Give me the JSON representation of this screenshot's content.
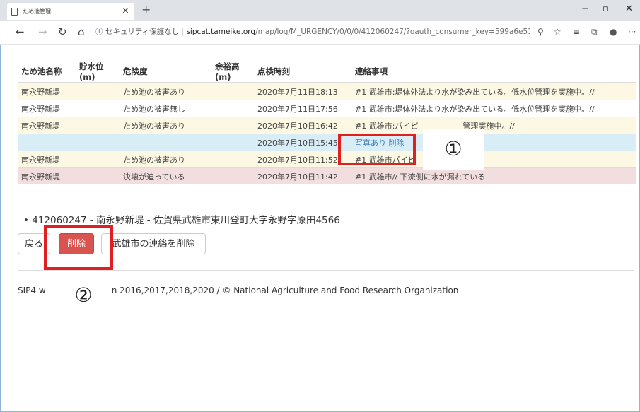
{
  "browser": {
    "tab_title": "ため池管理",
    "tab_close": "×",
    "new_tab": "+",
    "url_security": "ⓘ セキュリティ保護なし",
    "url_host": "sipcat.tameike.org",
    "url_path": "/map/log/M_URGENCY/0/0/0/412060247/?oauth_consumer_key=599a6e5190904..."
  },
  "table": {
    "headers": {
      "name": "ため池名称",
      "level": "貯水位(m)",
      "risk": "危険度",
      "margin": "余裕高(m)",
      "time": "点検時刻",
      "note": "連絡事項"
    },
    "rows": [
      {
        "name": "南永野新堤",
        "level": "",
        "risk": "ため池の被害あり",
        "margin": "",
        "time": "2020年7月11日18:13",
        "note": "#1 武雄市:堤体外法より水が染み出ている。低水位管理を実施中。//"
      },
      {
        "name": "南永野新堤",
        "level": "",
        "risk": "ため池の被害無し",
        "margin": "",
        "time": "2020年7月11日17:56",
        "note": "#1 武雄市:堤体外法より水が染み出ている。低水位管理を実施中。//"
      },
      {
        "name": "南永野新堤",
        "level": "",
        "risk": "ため池の被害あり",
        "margin": "",
        "time": "2020年7月10日16:42",
        "note": "#1 武雄市:パイピ                  管理実施中。//"
      },
      {
        "name": "",
        "level": "",
        "risk": "",
        "margin": "",
        "time": "2020年7月10日15:45",
        "note_link1": "写真あり",
        "note_link2": "削除"
      },
      {
        "name": "南永野新堤",
        "level": "",
        "risk": "ため池の被害あり",
        "margin": "",
        "time": "2020年7月10日11:52",
        "note": "#1 武雄市パイピ"
      },
      {
        "name": "南永野新堤",
        "level": "",
        "risk": "決壊が迫っている",
        "margin": "",
        "time": "2020年7月10日11:42",
        "note": "#1 武雄市// 下流側に水が漏れている"
      }
    ]
  },
  "location": "• 412060247 - 南永野新堤 - 佐賀県武雄市東川登町大字永野字原田4566",
  "buttons": {
    "back": "戻る",
    "delete": "削除",
    "delete_city": "武雄市の連絡を削除"
  },
  "footer": "SIP4 w          orporation 2016,2017,2018,2020 / © National Agriculture and Food Research Organization",
  "annotations": {
    "callout1": "①",
    "callout2": "②",
    "highlight_color": "#e02020"
  }
}
